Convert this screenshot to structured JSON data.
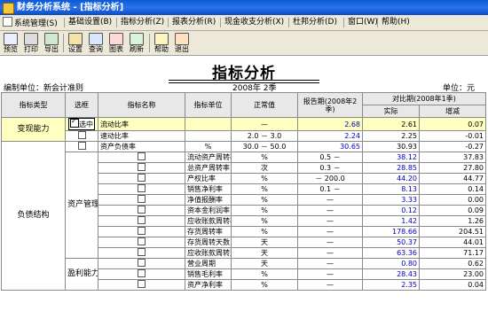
{
  "window": {
    "title": "财务分析系统 - [指标分析]"
  },
  "menu": [
    "系统管理(S)",
    "基础设置(B)",
    "指标分析(Z)",
    "报表分析(R)",
    "现金收支分析(X)",
    "杜邦分析(D)",
    "窗口(W)",
    "帮助(H)"
  ],
  "toolbar": [
    {
      "label": "预览",
      "icon": "preview-icon"
    },
    {
      "label": "打印",
      "icon": "print-icon"
    },
    {
      "label": "导出",
      "icon": "export-icon"
    },
    {
      "label": "设置",
      "icon": "settings-icon"
    },
    {
      "label": "查询",
      "icon": "query-icon"
    },
    {
      "label": "图表",
      "icon": "chart-icon"
    },
    {
      "label": "刷新",
      "icon": "refresh-icon"
    },
    {
      "label": "帮助",
      "icon": "help-icon"
    },
    {
      "label": "退出",
      "icon": "exit-icon"
    }
  ],
  "report": {
    "title": "指标分析",
    "org": "编制单位：新会计准则",
    "period": "2008年  2季",
    "unit": "单位：元"
  },
  "table": {
    "headers": {
      "type": "指标类型",
      "select": "选框",
      "name": "指标名称",
      "unit": "指标单位",
      "normal": "正常值",
      "report": "报告期(2008年2季)",
      "compare": "对比期(2008年1季)",
      "actual": "实际",
      "change": "增减"
    },
    "selected_label": "选中",
    "groups": [
      {
        "type": "变现能力",
        "rows": [
          0,
          1
        ]
      },
      {
        "type": "负债结构",
        "rows": [
          2
        ]
      },
      {
        "type": "资产管理",
        "rows": [
          3,
          12
        ]
      },
      {
        "type": "盈利能力",
        "rows": [
          13,
          15
        ]
      }
    ],
    "rows": [
      {
        "name": "流动比率",
        "unit": "",
        "normal": "—",
        "report": "2.68",
        "actual": "2.61",
        "change": "0.07"
      },
      {
        "name": "速动比率",
        "unit": "",
        "normal": "2.0 － 3.0",
        "report": "2.24",
        "actual": "2.25",
        "change": "-0.01"
      },
      {
        "name": "资产负债率",
        "unit": "%",
        "normal": "30.0 － 50.0",
        "report": "30.65",
        "actual": "30.93",
        "change": "-0.27"
      },
      {
        "name": "流动资产周转率",
        "unit": "%",
        "normal": "0.5 －",
        "report": "38.12",
        "actual": "37.83",
        "change": "0.28"
      },
      {
        "name": "总资产周转率",
        "unit": "次",
        "normal": "0.3 －",
        "report": "28.85",
        "actual": "27.80",
        "change": "1.05"
      },
      {
        "name": "产权比率",
        "unit": "%",
        "normal": "－ 200.0",
        "report": "44.20",
        "actual": "44.77",
        "change": "-0.57"
      },
      {
        "name": "销售净利率",
        "unit": "%",
        "normal": "0.1 －",
        "report": "8.13",
        "actual": "0.14",
        "change": "7.99"
      },
      {
        "name": "净值报酬率",
        "unit": "%",
        "normal": "—",
        "report": "3.33",
        "actual": "0.00",
        "change": "3.33"
      },
      {
        "name": "资本金利润率",
        "unit": "%",
        "normal": "—",
        "report": "0.12",
        "actual": "0.09",
        "change": "0.03"
      },
      {
        "name": "应收账款周转率",
        "unit": "%",
        "normal": "—",
        "report": "1.42",
        "actual": "1.26",
        "change": "0.16"
      },
      {
        "name": "存货周转率",
        "unit": "%",
        "normal": "—",
        "report": "178.66",
        "actual": "204.51",
        "change": "-25.84"
      },
      {
        "name": "存货周转天数",
        "unit": "天",
        "normal": "—",
        "report": "50.37",
        "actual": "44.01",
        "change": "6.37"
      },
      {
        "name": "应收账款周转天数",
        "unit": "天",
        "normal": "—",
        "report": "63.36",
        "actual": "71.17",
        "change": "-7.81"
      },
      {
        "name": "营业周期",
        "unit": "天",
        "normal": "—",
        "report": "0.80",
        "actual": "0.62",
        "change": "0.18"
      },
      {
        "name": "销售毛利率",
        "unit": "%",
        "normal": "—",
        "report": "28.43",
        "actual": "23.00",
        "change": "5.43"
      },
      {
        "name": "资产净利率",
        "unit": "%",
        "normal": "—",
        "report": "2.35",
        "actual": "0.04",
        "change": "2.31"
      }
    ]
  }
}
